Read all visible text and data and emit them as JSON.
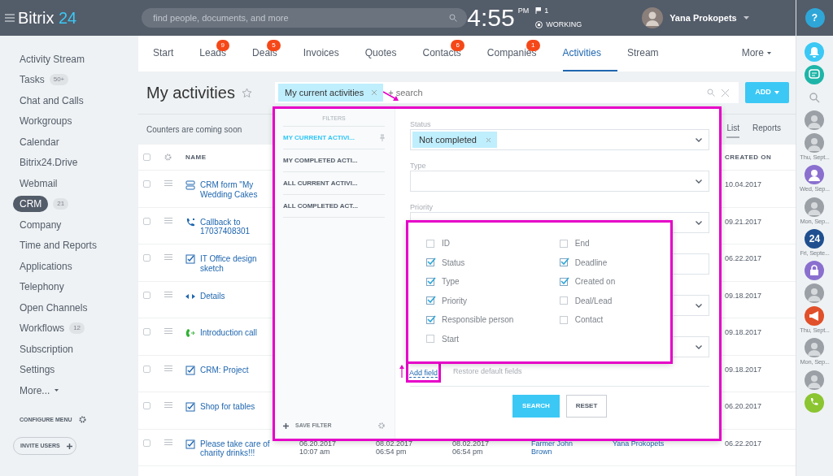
{
  "header": {
    "logo": {
      "name": "Bitrix",
      "suffix": "24"
    },
    "search": {
      "placeholder": "find people, documents, and more"
    },
    "clock": {
      "time": "4:55",
      "ampm": "PM",
      "flags": "1",
      "status": "WORKING"
    },
    "user": {
      "name": "Yana Prokopets"
    },
    "help": "?"
  },
  "tabs": [
    {
      "label": "Start",
      "selected": false
    },
    {
      "label": "Leads",
      "badge": "9",
      "selected": false
    },
    {
      "label": "Deals",
      "badge": "5",
      "selected": false
    },
    {
      "label": "Invoices",
      "selected": false
    },
    {
      "label": "Quotes",
      "selected": false
    },
    {
      "label": "Contacts",
      "badge": "6",
      "selected": false
    },
    {
      "label": "Companies",
      "badge": "1",
      "selected": false
    },
    {
      "label": "Activities",
      "selected": true
    },
    {
      "label": "Stream",
      "selected": false
    }
  ],
  "more_tab": "More",
  "sidebar": {
    "items": [
      {
        "label": "Activity Stream",
        "selected": false
      },
      {
        "label": "Tasks",
        "count": "50+",
        "selected": false
      },
      {
        "label": "Chat and Calls",
        "selected": false
      },
      {
        "label": "Workgroups",
        "selected": false
      },
      {
        "label": "Calendar",
        "selected": false
      },
      {
        "label": "Bitrix24.Drive",
        "selected": false
      },
      {
        "label": "Webmail",
        "selected": false
      },
      {
        "label": "CRM",
        "count": "21",
        "selected": true
      },
      {
        "label": "Company",
        "selected": false
      },
      {
        "label": "Time and Reports",
        "selected": false
      },
      {
        "label": "Applications",
        "selected": false
      },
      {
        "label": "Telephony",
        "selected": false
      },
      {
        "label": "Open Channels",
        "selected": false
      },
      {
        "label": "Workflows",
        "count": "12",
        "selected": false
      },
      {
        "label": "Subscription",
        "selected": false
      },
      {
        "label": "Settings",
        "selected": false
      },
      {
        "label": "More...",
        "selected": false
      }
    ],
    "configure": "CONFIGURE MENU",
    "invite": "INVITE USERS"
  },
  "page": {
    "title": "My activities",
    "filter_chip": "My current activities",
    "filter_placeholder": "+ search",
    "add_button": "ADD",
    "counters": "Counters are coming soon",
    "views": [
      {
        "label": "List",
        "selected": true
      },
      {
        "label": "Reports",
        "selected": false
      }
    ]
  },
  "table": {
    "columns": [
      "NAME",
      "CREATED ON"
    ],
    "all_checked": false,
    "rows": [
      {
        "kind": "form",
        "checked": false,
        "name": "CRM form \"My Wedding Cakes",
        "created_on": "10.04.2017"
      },
      {
        "kind": "callback",
        "checked": false,
        "name": "Callback to 17037408301",
        "created_on": "09.21.2017"
      },
      {
        "kind": "task",
        "checked": false,
        "name": "IT Office design sketch",
        "created_on": "06.22.2017"
      },
      {
        "kind": "details",
        "checked": false,
        "name": "Details",
        "created_on": "09.18.2017"
      },
      {
        "kind": "call",
        "checked": false,
        "name": "Introduction call",
        "created_on": "09.18.2017"
      },
      {
        "kind": "task",
        "checked": false,
        "name": "CRM: Project",
        "created_on": "09.18.2017"
      },
      {
        "kind": "task",
        "checked": false,
        "name": "Shop for tables",
        "created_on": "06.20.2017"
      },
      {
        "kind": "task",
        "checked": false,
        "name": "Please take care of charity drinks!!!",
        "created_on": "06.22.2017",
        "cells": [
          {
            "kind": "date",
            "lines": [
              "06.20.2017",
              "10:07 am"
            ]
          },
          {
            "kind": "date",
            "lines": [
              "08.02.2017",
              "06:54 pm"
            ]
          },
          {
            "kind": "date",
            "lines": [
              "08.02.2017",
              "06:54 pm"
            ]
          },
          {
            "kind": "link",
            "lines": [
              "Farmer John",
              "Brown"
            ]
          },
          {
            "kind": "link",
            "lines": [
              "Yana Prokopets"
            ]
          }
        ]
      }
    ]
  },
  "filter_popup": {
    "highlighted": true,
    "pointer_arrow": true,
    "title": "FILTERS",
    "presets": [
      {
        "label": "MY CURRENT ACTIVI...",
        "selected": true,
        "pinned": true
      },
      {
        "label": "MY COMPLETED ACTI...",
        "selected": false,
        "pinned": false
      },
      {
        "label": "ALL CURRENT ACTIVI...",
        "selected": false,
        "pinned": false
      },
      {
        "label": "ALL COMPLETED ACT...",
        "selected": false,
        "pinned": false
      }
    ],
    "save_filter": "SAVE FILTER",
    "fields": [
      {
        "label": "Status",
        "kind": "select",
        "chips": [
          "Not completed"
        ]
      },
      {
        "label": "Type",
        "kind": "select"
      },
      {
        "label": "Priority",
        "kind": "select"
      },
      {
        "kind": "input"
      },
      {
        "kind": "select"
      },
      {
        "kind": "select"
      }
    ],
    "add_field": {
      "label": "Add field",
      "highlighted": true,
      "pointer_arrow": true
    },
    "restore": "Restore default fields",
    "search_button": "SEARCH",
    "reset_button": "RESET",
    "field_chooser": {
      "highlighted": true,
      "columns": [
        [
          {
            "label": "ID",
            "checked": false
          },
          {
            "label": "Status",
            "checked": true
          },
          {
            "label": "Type",
            "checked": true
          },
          {
            "label": "Priority",
            "checked": true
          },
          {
            "label": "Responsible person",
            "checked": true
          },
          {
            "label": "Start",
            "checked": false
          }
        ],
        [
          {
            "label": "End",
            "checked": false
          },
          {
            "label": "Deadline",
            "checked": true
          },
          {
            "label": "Created on",
            "checked": true
          },
          {
            "label": "Deal/Lead",
            "checked": false
          },
          {
            "label": "Contact",
            "checked": false
          }
        ]
      ]
    }
  },
  "right_rail": [
    {
      "kind": "bell"
    },
    {
      "kind": "chat"
    },
    {
      "kind": "search"
    },
    {
      "kind": "avatar"
    },
    {
      "kind": "avatar",
      "caption": "Thu, Sept..."
    },
    {
      "kind": "user",
      "caption": "Wed, Sep..."
    },
    {
      "kind": "avatar",
      "caption": "Mon, Sep..."
    },
    {
      "kind": "number",
      "text": "24",
      "caption": "Fri, Septe..."
    },
    {
      "kind": "lock"
    },
    {
      "kind": "avatar"
    },
    {
      "kind": "megaphone",
      "caption": "Thu, Sept..."
    },
    {
      "kind": "avatar",
      "caption": "Mon, Sep..."
    },
    {
      "kind": "avatar"
    },
    {
      "kind": "phone"
    }
  ]
}
